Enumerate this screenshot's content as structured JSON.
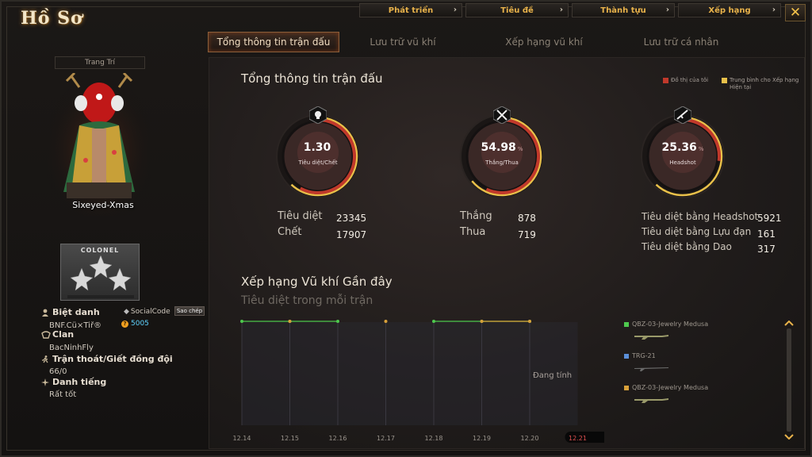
{
  "title": "Hồ Sơ",
  "top_menu": [
    {
      "label": "Phát triển"
    },
    {
      "label": "Tiêu đề"
    },
    {
      "label": "Thành tựu"
    },
    {
      "label": "Xếp hạng"
    }
  ],
  "close_label": "✕",
  "tabs": [
    {
      "label": "Tổng thông tin trận đấu",
      "active": true
    },
    {
      "label": "Lưu trữ vũ khí",
      "active": false
    },
    {
      "label": "Xếp hạng vũ khí",
      "active": false
    },
    {
      "label": "Lưu trữ cá nhân",
      "active": false
    }
  ],
  "profile": {
    "decor_label": "Trang Trí",
    "nickname": "Sixeyed-Xmas",
    "rank": "COLONEL",
    "nickname_label": "Biệt danh",
    "nickname_value": "BNF.Cü×Tiř®",
    "social_code_label": "SocialCode",
    "copy_label": "Sao chép",
    "coins": "5005",
    "clan_label": "Clan",
    "clan_value": "BacNinhFly",
    "escape_label": "Trận thoát/Giết đồng đội",
    "escape_value": "66/0",
    "reputation_label": "Danh tiếng",
    "reputation_value": "Rất tốt"
  },
  "overview": {
    "title": "Tổng thông tin trận đấu",
    "legend": [
      {
        "label": "Đồ thị của tôi",
        "color": "#c0392b"
      },
      {
        "label": "Trung bình cho Xếp hạng Hiện tại",
        "color": "#e8c04a"
      }
    ],
    "gauges": [
      {
        "value": "1.30",
        "pct": "",
        "label": "Tiêu diệt/Chết",
        "fraction": 0.56,
        "avg": 0.6,
        "icon": "skull-icon"
      },
      {
        "value": "54.98",
        "pct": "%",
        "label": "Thắng/Thua",
        "fraction": 0.55,
        "avg": 0.62,
        "icon": "crossed-swords-icon"
      },
      {
        "value": "25.36",
        "pct": "%",
        "label": "Headshot",
        "fraction": 0.25,
        "avg": 0.6,
        "icon": "rifle-icon"
      }
    ],
    "stats": {
      "kills_label": "Tiêu diệt",
      "kills": "23345",
      "deaths_label": "Chết",
      "deaths": "17907",
      "wins_label": "Thắng",
      "wins": "878",
      "losses_label": "Thua",
      "losses": "719",
      "hs_label": "Tiêu diệt bằng Headshot",
      "hs": "5921",
      "grenade_label": "Tiêu diệt bằng Lựu đạn",
      "grenade": "161",
      "knife_label": "Tiêu diệt bằng Dao",
      "knife": "317"
    }
  },
  "recent": {
    "title": "Xếp hạng Vũ khí Gần đây",
    "subtitle": "Tiêu diệt trong mỗi trận",
    "computing": "Đang tính",
    "weapons": [
      {
        "name": "QBZ-03-Jewelry Medusa",
        "color": "#4ec94e"
      },
      {
        "name": "TRG-21",
        "color": "#5b8fd8"
      },
      {
        "name": "QBZ-03-Jewelry Medusa",
        "color": "#d8a03a"
      }
    ]
  },
  "chart_data": {
    "type": "line",
    "title": "Xếp hạng Vũ khí Gần đây",
    "subtitle": "Tiêu diệt trong mỗi trận",
    "categories": [
      "12.14",
      "12.15",
      "12.16",
      "12.17",
      "12.18",
      "12.19",
      "12.20",
      "12.21"
    ],
    "highlight_category": "12.21",
    "series": [
      {
        "name": "QBZ-03-Jewelry Medusa",
        "color": "#4ec94e",
        "values": [
          1,
          1,
          1,
          null,
          1,
          1,
          1,
          null
        ]
      },
      {
        "name": "TRG-21",
        "color": "#5b8fd8",
        "values": [
          null,
          null,
          null,
          null,
          null,
          null,
          null,
          null
        ]
      },
      {
        "name": "QBZ-03-Jewelry Medusa",
        "color": "#d8a03a",
        "values": [
          null,
          1,
          null,
          1,
          null,
          1,
          1,
          null
        ]
      }
    ]
  }
}
